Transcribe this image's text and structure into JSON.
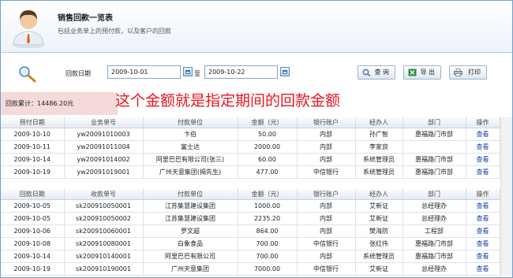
{
  "header": {
    "title": "销售回款一览表",
    "subtitle": "包括业务单上的预付款，以及客户的回款"
  },
  "filter": {
    "date_label": "回款日期",
    "start_date": "2009-10-01",
    "separator": "至",
    "end_date": "2009-10-22"
  },
  "toolbar": {
    "query_label": "查 询",
    "export_label": "导 出",
    "print_label": "打印"
  },
  "summary": {
    "text": "回款累计：14486.20元"
  },
  "annotation": {
    "text": "这个金额就是指定期间的回款金额"
  },
  "prepay_table": {
    "columns": [
      "预付日期",
      "业务单号",
      "付款单位",
      "金额（元）",
      "银行账户",
      "经办人",
      "部门",
      "操作"
    ],
    "rows": [
      [
        "2009-10-10",
        "yw20091010003",
        "卞伯",
        "50.00",
        "内部",
        "孙广智",
        "惠福路门市部",
        "查看"
      ],
      [
        "2009-10-11",
        "yw20091011004",
        "富士达",
        "2000.00",
        "内部",
        "李家良",
        "",
        "查看"
      ],
      [
        "2009-10-14",
        "yw20091014002",
        "阿里巴巴有限公司(张三)",
        "60.00",
        "内部",
        "系统管理员",
        "惠福路门市部",
        "查看"
      ],
      [
        "2009-10-19",
        "yw20091019001",
        "广州天意集团(揭先生)",
        "477.00",
        "中信银行",
        "系统管理员",
        "惠福路门市部",
        "查看"
      ]
    ]
  },
  "receipt_table": {
    "columns": [
      "回款日期",
      "收款单号",
      "付款单位",
      "金额（元）",
      "银行账户",
      "经办人",
      "部门",
      "操作"
    ],
    "rows": [
      [
        "2009-10-05",
        "sk200910050001",
        "江苏集慧建设集团",
        "1000.00",
        "内部",
        "艾新证",
        "总经理办",
        "查看"
      ],
      [
        "2009-10-05",
        "sk200910050002",
        "江苏集慧建设集团",
        "2235.20",
        "内部",
        "艾新证",
        "总经理办",
        "查看"
      ],
      [
        "2009-10-06",
        "sk200910060001",
        "罗文超",
        "864.00",
        "内部",
        "樊海防",
        "工程部",
        "查看"
      ],
      [
        "2009-10-08",
        "sk200910080001",
        "白象食品",
        "700.00",
        "中信银行",
        "张红伟",
        "惠福路门市部",
        "查看"
      ],
      [
        "2009-10-14",
        "sk200910140001",
        "阿里巴巴有限公司",
        "700.00",
        "内部",
        "系统管理员",
        "惠福路门市部",
        "查看"
      ],
      [
        "2009-10-19",
        "sk200910190001",
        "广州天意集团",
        "7000.00",
        "中信银行",
        "艾新证",
        "总经理办",
        "查看"
      ]
    ]
  }
}
